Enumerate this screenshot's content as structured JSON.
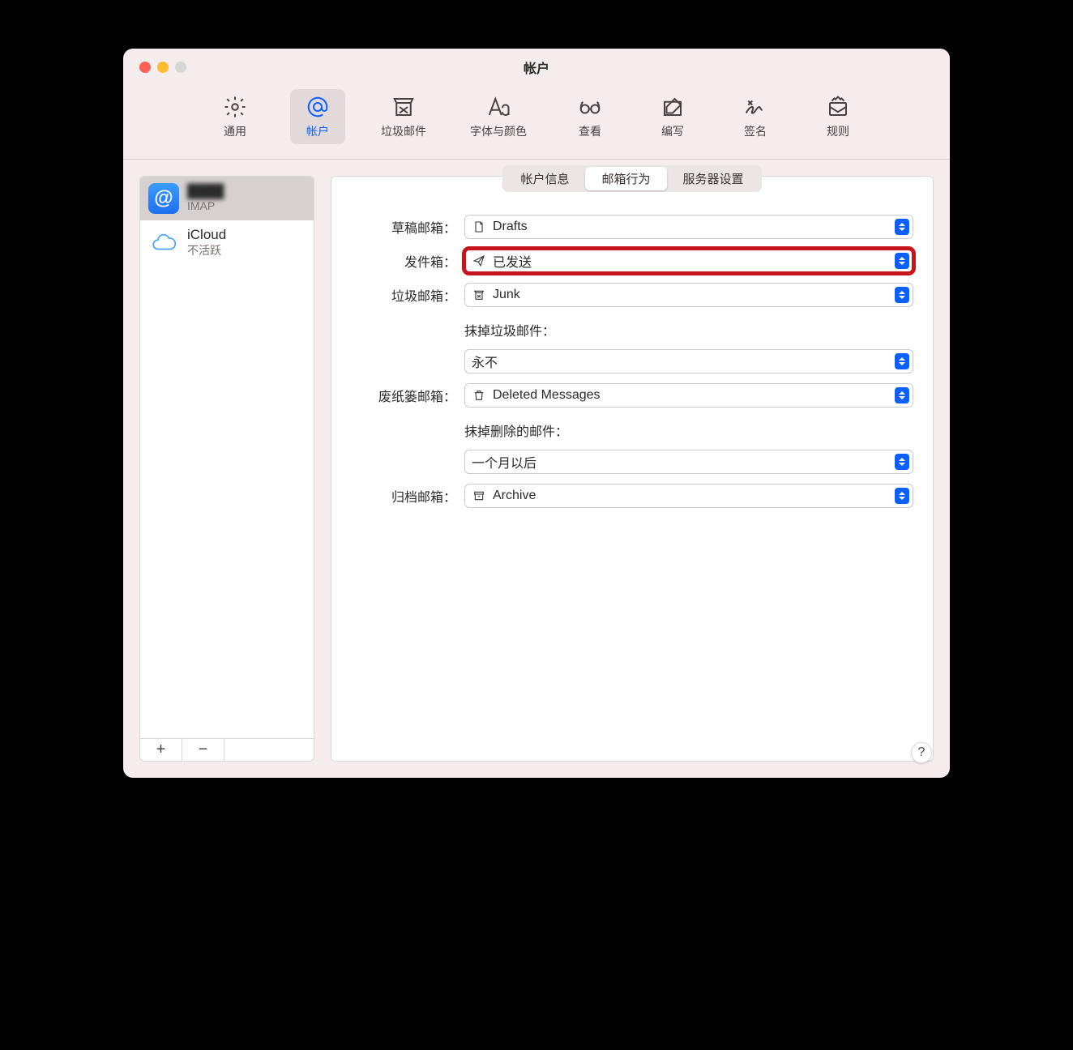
{
  "window": {
    "title": "帐户"
  },
  "toolbar": {
    "items": [
      {
        "id": "general",
        "label": "通用"
      },
      {
        "id": "accounts",
        "label": "帐户"
      },
      {
        "id": "junk",
        "label": "垃圾邮件"
      },
      {
        "id": "fonts",
        "label": "字体与颜色"
      },
      {
        "id": "viewing",
        "label": "查看"
      },
      {
        "id": "composing",
        "label": "编写"
      },
      {
        "id": "signatures",
        "label": "签名"
      },
      {
        "id": "rules",
        "label": "规则"
      }
    ],
    "active": "accounts"
  },
  "sidebar": {
    "accounts": [
      {
        "name": "████",
        "subtitle": "IMAP",
        "icon": "at",
        "selected": true,
        "redacted": true
      },
      {
        "name": "iCloud",
        "subtitle": "不活跃",
        "icon": "cloud",
        "selected": false,
        "redacted": false
      }
    ],
    "add_label": "+",
    "remove_label": "−"
  },
  "tabs": {
    "items": [
      "帐户信息",
      "邮箱行为",
      "服务器设置"
    ],
    "active_index": 1
  },
  "form": {
    "drafts": {
      "label": "草稿邮箱：",
      "value": "Drafts",
      "icon": "document"
    },
    "sent": {
      "label": "发件箱：",
      "value": "已发送",
      "icon": "paperplane",
      "highlighted": true
    },
    "junk": {
      "label": "垃圾邮箱：",
      "value": "Junk",
      "icon": "junkbox"
    },
    "erase_junk": {
      "label": "抹掉垃圾邮件：",
      "value": "永不"
    },
    "trash": {
      "label": "废纸篓邮箱：",
      "value": "Deleted Messages",
      "icon": "trash"
    },
    "erase_deleted": {
      "label": "抹掉删除的邮件：",
      "value": "一个月以后"
    },
    "archive": {
      "label": "归档邮箱：",
      "value": "Archive",
      "icon": "archivebox"
    }
  },
  "help": {
    "label": "?"
  }
}
